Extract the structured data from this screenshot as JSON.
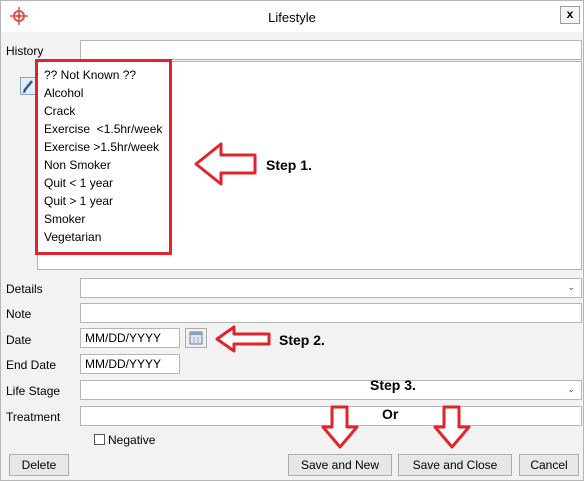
{
  "window": {
    "title": "Lifestyle",
    "close_label": "x"
  },
  "labels": {
    "history": "History",
    "details": "Details",
    "note": "Note",
    "date": "Date",
    "end_date": "End Date",
    "life_stage": "Life Stage",
    "treatment": "Treatment"
  },
  "history_list": {
    "items": [
      "?? Not Known ??",
      "Alcohol",
      "Crack",
      "Exercise  <1.5hr/week",
      "Exercise >1.5hr/week",
      "Non Smoker",
      "Quit < 1 year",
      "Quit > 1 year",
      "Smoker",
      "Vegetarian"
    ]
  },
  "fields": {
    "history_value": "",
    "details_value": "",
    "note_value": "",
    "date_value": "MM/DD/YYYY",
    "end_date_value": "MM/DD/YYYY",
    "life_stage_value": "",
    "treatment_value": ""
  },
  "checkbox": {
    "negative_label": "Negative",
    "checked": false
  },
  "buttons": {
    "delete": "Delete",
    "save_new": "Save and New",
    "save_close": "Save and Close",
    "cancel": "Cancel"
  },
  "annotations": {
    "step1": "Step 1.",
    "step2": "Step 2.",
    "step3": "Step 3.",
    "or": "Or",
    "color": "#e3232a"
  }
}
